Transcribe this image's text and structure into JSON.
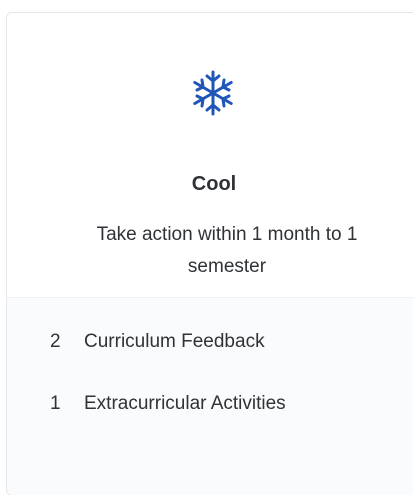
{
  "card": {
    "icon": "snowflake-icon",
    "icon_color": "#1f56b8",
    "title": "Cool",
    "subtitle": "Take action within 1 month to 1 semester"
  },
  "items": [
    {
      "count": "2",
      "label": "Curriculum Feedback"
    },
    {
      "count": "1",
      "label": "Extracurricular Activities"
    }
  ]
}
